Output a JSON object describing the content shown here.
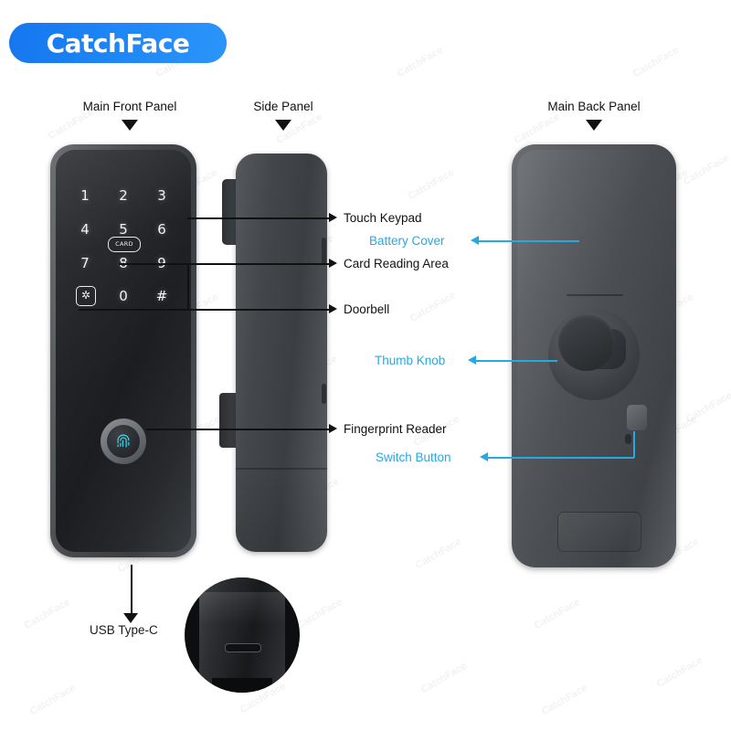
{
  "brand": {
    "logo_text": "CatchFace",
    "logo_color": "#1a7bf0"
  },
  "accent": {
    "blue": "#29a8e0",
    "dark": "#111111"
  },
  "top_labels": [
    {
      "id": "main-front-panel",
      "text": "Main Front Panel"
    },
    {
      "id": "side-panel",
      "text": "Side Panel"
    },
    {
      "id": "main-back-panel",
      "text": "Main Back Panel"
    }
  ],
  "callouts_right": [
    {
      "id": "touch-keypad",
      "text": "Touch Keypad"
    },
    {
      "id": "card-reading-area",
      "text": "Card Reading Area"
    },
    {
      "id": "doorbell",
      "text": "Doorbell"
    },
    {
      "id": "fingerprint-reader",
      "text": "Fingerprint Reader"
    }
  ],
  "callouts_blue": [
    {
      "id": "battery-cover",
      "text": "Battery Cover"
    },
    {
      "id": "thumb-knob",
      "text": "Thumb Knob"
    },
    {
      "id": "switch-button",
      "text": "Switch Button"
    }
  ],
  "callouts_bottom": [
    {
      "id": "usb-type-c",
      "text": "USB Type-C"
    }
  ],
  "keypad": {
    "rows": [
      [
        "1",
        "2",
        "3"
      ],
      [
        "4",
        "5",
        "6"
      ],
      [
        "7",
        "8",
        "9"
      ],
      [
        "",
        "0",
        "#"
      ]
    ],
    "card_label": "CARD",
    "doorbell_glyph": "✲"
  },
  "watermark": {
    "text": "CatchFace"
  }
}
